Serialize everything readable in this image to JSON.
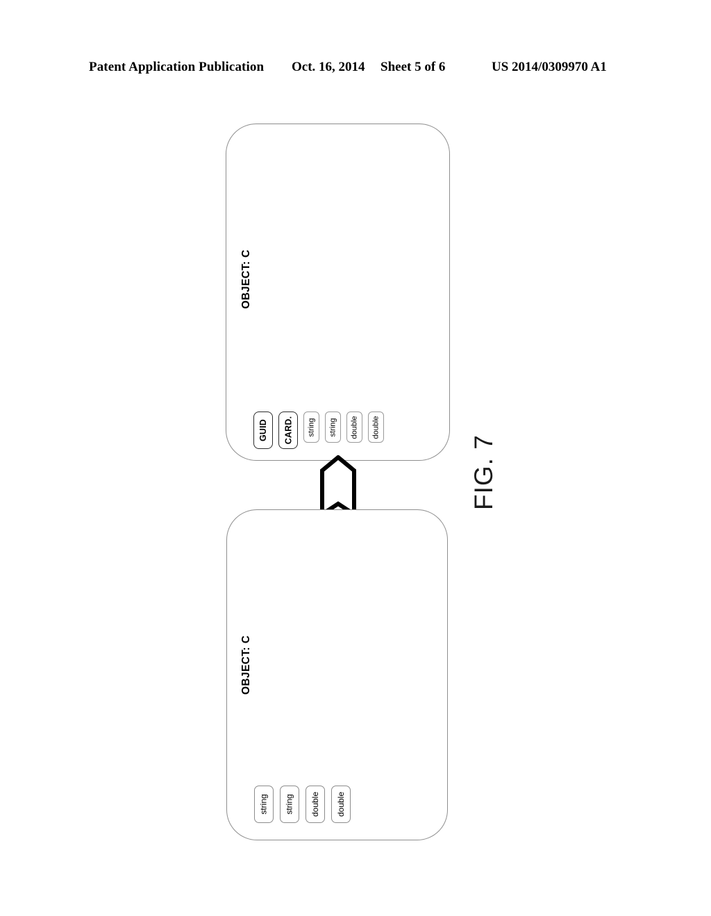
{
  "header": {
    "publication": "Patent Application Publication",
    "date": "Oct. 16, 2014",
    "sheet": "Sheet 5 of 6",
    "document_number": "US 2014/0309970 A1"
  },
  "figure": {
    "caption": "FIG. 7",
    "connector": {
      "icon": "up-block-arrow-icon"
    },
    "objects": [
      {
        "id": "object-c-top",
        "title": "OBJECT: C",
        "attributes": [
          {
            "label": "GUID",
            "kind": "key"
          },
          {
            "label": "CARD.",
            "kind": "key"
          },
          {
            "label": "string",
            "kind": "type"
          },
          {
            "label": "string",
            "kind": "type"
          },
          {
            "label": "double",
            "kind": "type"
          },
          {
            "label": "double",
            "kind": "type"
          }
        ]
      },
      {
        "id": "object-c-bottom",
        "title": "OBJECT: C",
        "attributes": [
          {
            "label": "string",
            "kind": "type"
          },
          {
            "label": "string",
            "kind": "type"
          },
          {
            "label": "double",
            "kind": "type"
          },
          {
            "label": "double",
            "kind": "type"
          }
        ]
      }
    ]
  },
  "colors": {
    "page_background": "#ffffff",
    "ink": "#000000",
    "box_stroke": "#8e8e8e",
    "key_pill_stroke": "#2b2b2b",
    "type_pill_stroke": "#9a9a9a"
  }
}
